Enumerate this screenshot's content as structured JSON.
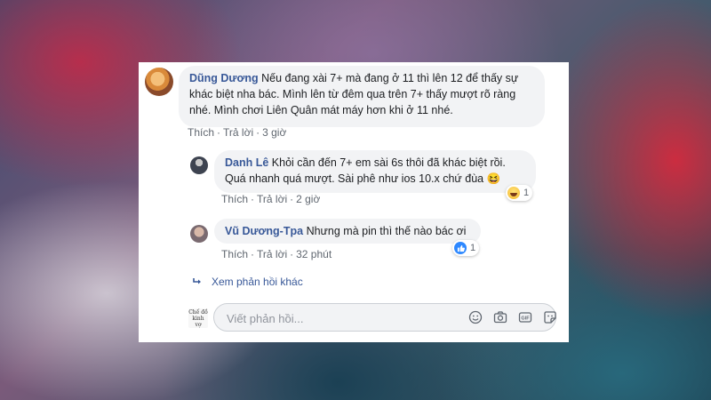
{
  "comment": {
    "author": "Dũng Dương",
    "text": "Nếu đang xài 7+ mà đang ở 11 thì lên 12 để thấy sự khác biệt nha bác. Mình lên từ đêm qua trên 7+ thấy mượt rõ ràng nhé. Mình chơi Liên Quân mát máy hơn khi ở 11 nhé.",
    "like_label": "Thích",
    "reply_label": "Trả lời",
    "time": "3 giờ"
  },
  "replies": [
    {
      "author": "Danh Lê",
      "text": "Khỏi cần đến 7+ em sài 6s thôi đã khác biệt rồi. Quá nhanh quá mượt. Sài phê như ios 10.x chứ đùa",
      "emoji": "😆",
      "like_label": "Thích",
      "reply_label": "Trả lời",
      "time": "2 giờ",
      "reaction_icon": "haha-icon",
      "reaction_count": "1"
    },
    {
      "author": "Vũ Dương-Tpa",
      "text": "Nhưng mà pin thì thế nào bác ơi",
      "like_label": "Thích",
      "reply_label": "Trả lời",
      "time": "32 phút",
      "reaction_icon": "like-icon",
      "reaction_count": "1"
    }
  ],
  "more_replies_label": "Xem phản hồi khác",
  "reply_box": {
    "placeholder": "Viết phản hồi...",
    "avatar_text": "Chế đồ kinh vợ",
    "icons": [
      "emoji-icon",
      "camera-icon",
      "gif-icon",
      "sticker-icon"
    ]
  },
  "colors": {
    "author": "#385898",
    "bubble": "#f2f3f5",
    "meta": "#606770",
    "like_blue": "#2d88ff"
  }
}
